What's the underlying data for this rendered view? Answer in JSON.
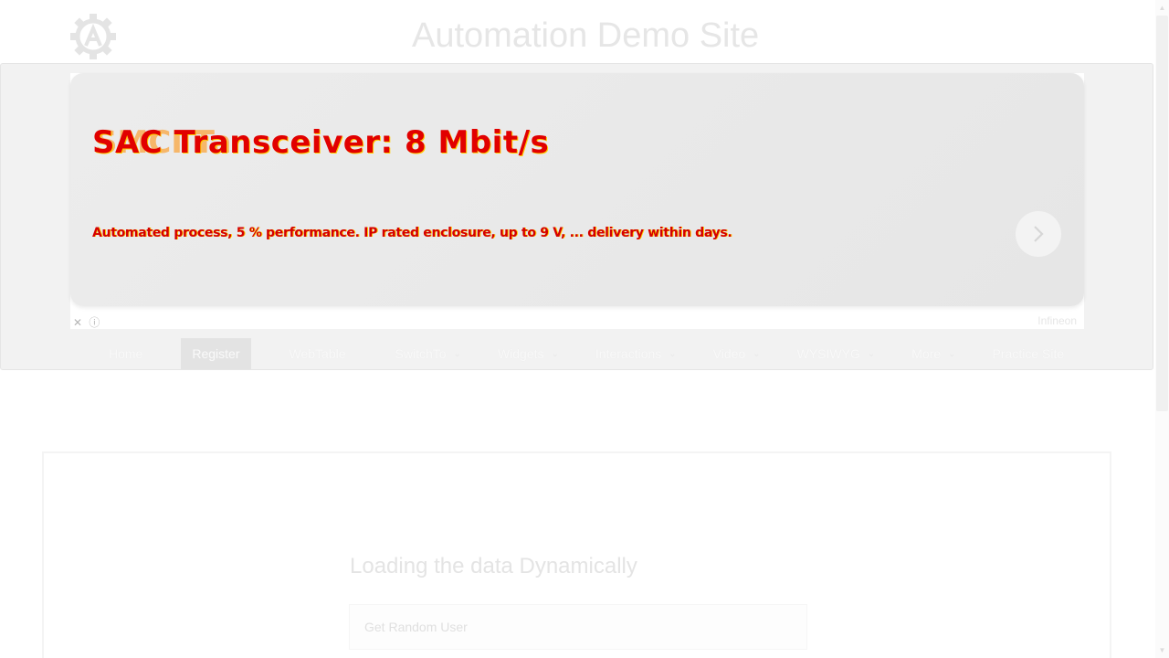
{
  "header": {
    "title": "Automation Demo Site",
    "logo_icon": "gear-logo-icon"
  },
  "ad": {
    "headline": "SAC Transceiver: 8 Mbit/s",
    "headline_overlay": "SMCI Ta",
    "body": "Automated process, 5 % performance. IP rated enclosure, up to 9 V, ... delivery within days.",
    "close_glyph": "✕",
    "info_glyph": "ⓘ",
    "brand": "Infineon",
    "colors": {
      "headline": "#e10000",
      "accent": "#ffcc00"
    }
  },
  "nav": {
    "items": [
      {
        "label": "Home",
        "has_caret": false
      },
      {
        "label": "Register",
        "has_caret": false,
        "active": true
      },
      {
        "label": "WebTable",
        "has_caret": false
      },
      {
        "label": "SwitchTo",
        "has_caret": true
      },
      {
        "label": "Widgets",
        "has_caret": true
      },
      {
        "label": "Interactions",
        "has_caret": true
      },
      {
        "label": "Video",
        "has_caret": true
      },
      {
        "label": "WYSIWYG",
        "has_caret": true
      },
      {
        "label": "More",
        "has_caret": true
      },
      {
        "label": "Practice Site",
        "has_caret": false
      }
    ],
    "caret_glyph": "⌄"
  },
  "main": {
    "heading": "Loading the data Dynamically",
    "button_label": "Get Random User"
  },
  "scrollbar": {
    "up_glyph": "▲",
    "down_glyph": "▼"
  }
}
